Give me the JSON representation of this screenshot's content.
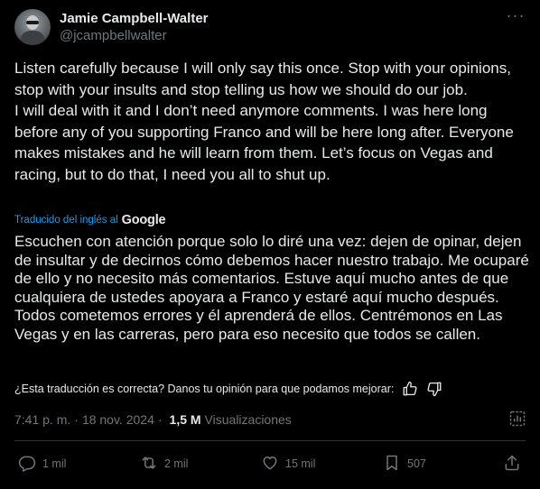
{
  "author": {
    "display_name": "Jamie Campbell-Walter",
    "handle": "@jcampbellwalter"
  },
  "tweet": {
    "paragraphs": [
      "Listen carefully because I will only say this once. Stop with your opinions, stop with your insults and stop telling us how we should do our job.",
      "I will deal with it and I don’t need anymore comments. I was here long before any of you supporting Franco and will be here long after. Everyone makes mistakes and he will learn from them. Let’s focus on Vegas and racing, but to do that, I need you all to shut up."
    ],
    "translated_label": "Traducido del inglés al",
    "translator": "Google",
    "translation": "Escuchen con atención porque solo lo diré una vez: dejen de opinar, dejen de insultar y de decirnos cómo debemos hacer nuestro trabajo. Me ocuparé de ello y no necesito más comentarios. Estuve aquí mucho antes de que cualquiera de ustedes apoyara a Franco y estaré aquí mucho después. Todos cometemos errores y él aprenderá de ellos. Centrémonos en Las Vegas y en las carreras, pero para eso necesito que todos se callen.",
    "feedback_question": "¿Esta traducción es correcta? Danos tu opinión para que podamos mejorar:"
  },
  "meta": {
    "time": "7:41 p. m.",
    "separator": "·",
    "date": "18 nov. 2024",
    "views_count": "1,5 M",
    "views_label": "Visualizaciones"
  },
  "actions": {
    "replies": "1 mil",
    "reposts": "2 mil",
    "likes": "15 mil",
    "bookmarks": "507"
  },
  "icons": {
    "more": "more-options-icon",
    "thumbs_up": "thumbs-up-icon",
    "thumbs_down": "thumbs-down-icon",
    "stats": "post-analytics-icon",
    "reply": "reply-icon",
    "repost": "repost-icon",
    "like": "heart-icon",
    "bookmark": "bookmark-icon",
    "share": "share-icon"
  },
  "colors": {
    "background": "#000000",
    "text": "#e7e9ea",
    "muted": "#71767b",
    "link": "#1d9bf0"
  }
}
